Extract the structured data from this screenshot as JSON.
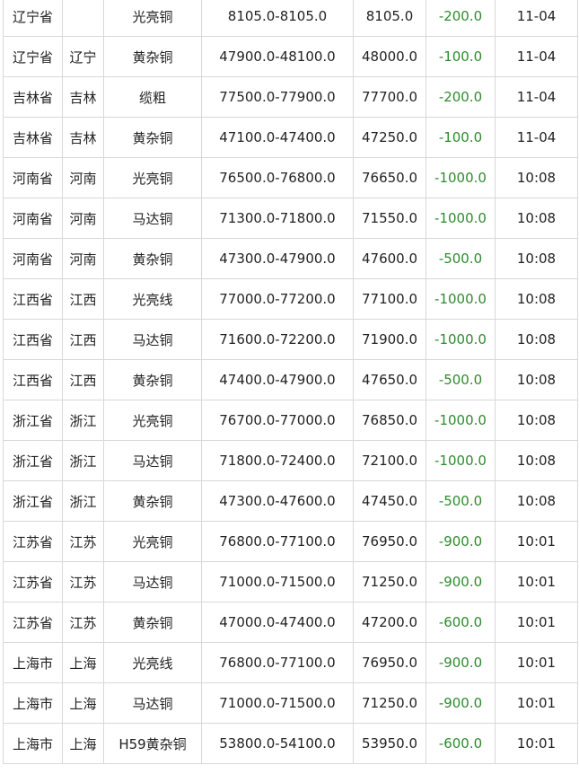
{
  "rows": [
    {
      "province": "辽宁省",
      "city": "",
      "product": "光亮铜",
      "range": "8105.0-8105.0",
      "avg": "8105.0",
      "change": "-200.0",
      "date": "11-04"
    },
    {
      "province": "辽宁省",
      "city": "辽宁",
      "product": "黄杂铜",
      "range": "47900.0-48100.0",
      "avg": "48000.0",
      "change": "-100.0",
      "date": "11-04"
    },
    {
      "province": "吉林省",
      "city": "吉林",
      "product": "缆粗",
      "range": "77500.0-77900.0",
      "avg": "77700.0",
      "change": "-200.0",
      "date": "11-04"
    },
    {
      "province": "吉林省",
      "city": "吉林",
      "product": "黄杂铜",
      "range": "47100.0-47400.0",
      "avg": "47250.0",
      "change": "-100.0",
      "date": "11-04"
    },
    {
      "province": "河南省",
      "city": "河南",
      "product": "光亮铜",
      "range": "76500.0-76800.0",
      "avg": "76650.0",
      "change": "-1000.0",
      "date": "10:08"
    },
    {
      "province": "河南省",
      "city": "河南",
      "product": "马达铜",
      "range": "71300.0-71800.0",
      "avg": "71550.0",
      "change": "-1000.0",
      "date": "10:08"
    },
    {
      "province": "河南省",
      "city": "河南",
      "product": "黄杂铜",
      "range": "47300.0-47900.0",
      "avg": "47600.0",
      "change": "-500.0",
      "date": "10:08"
    },
    {
      "province": "江西省",
      "city": "江西",
      "product": "光亮线",
      "range": "77000.0-77200.0",
      "avg": "77100.0",
      "change": "-1000.0",
      "date": "10:08"
    },
    {
      "province": "江西省",
      "city": "江西",
      "product": "马达铜",
      "range": "71600.0-72200.0",
      "avg": "71900.0",
      "change": "-1000.0",
      "date": "10:08"
    },
    {
      "province": "江西省",
      "city": "江西",
      "product": "黄杂铜",
      "range": "47400.0-47900.0",
      "avg": "47650.0",
      "change": "-500.0",
      "date": "10:08"
    },
    {
      "province": "浙江省",
      "city": "浙江",
      "product": "光亮铜",
      "range": "76700.0-77000.0",
      "avg": "76850.0",
      "change": "-1000.0",
      "date": "10:08"
    },
    {
      "province": "浙江省",
      "city": "浙江",
      "product": "马达铜",
      "range": "71800.0-72400.0",
      "avg": "72100.0",
      "change": "-1000.0",
      "date": "10:08"
    },
    {
      "province": "浙江省",
      "city": "浙江",
      "product": "黄杂铜",
      "range": "47300.0-47600.0",
      "avg": "47450.0",
      "change": "-500.0",
      "date": "10:08"
    },
    {
      "province": "江苏省",
      "city": "江苏",
      "product": "光亮铜",
      "range": "76800.0-77100.0",
      "avg": "76950.0",
      "change": "-900.0",
      "date": "10:01"
    },
    {
      "province": "江苏省",
      "city": "江苏",
      "product": "马达铜",
      "range": "71000.0-71500.0",
      "avg": "71250.0",
      "change": "-900.0",
      "date": "10:01"
    },
    {
      "province": "江苏省",
      "city": "江苏",
      "product": "黄杂铜",
      "range": "47000.0-47400.0",
      "avg": "47200.0",
      "change": "-600.0",
      "date": "10:01"
    },
    {
      "province": "上海市",
      "city": "上海",
      "product": "光亮线",
      "range": "76800.0-77100.0",
      "avg": "76950.0",
      "change": "-900.0",
      "date": "10:01"
    },
    {
      "province": "上海市",
      "city": "上海",
      "product": "马达铜",
      "range": "71000.0-71500.0",
      "avg": "71250.0",
      "change": "-900.0",
      "date": "10:01"
    },
    {
      "province": "上海市",
      "city": "上海",
      "product": "H59黄杂铜",
      "range": "53800.0-54100.0",
      "avg": "53950.0",
      "change": "-600.0",
      "date": "10:01"
    }
  ],
  "colors": {
    "change_text": "#2e8b2e",
    "grid_line": "#d8d8d8",
    "text": "#222222"
  }
}
